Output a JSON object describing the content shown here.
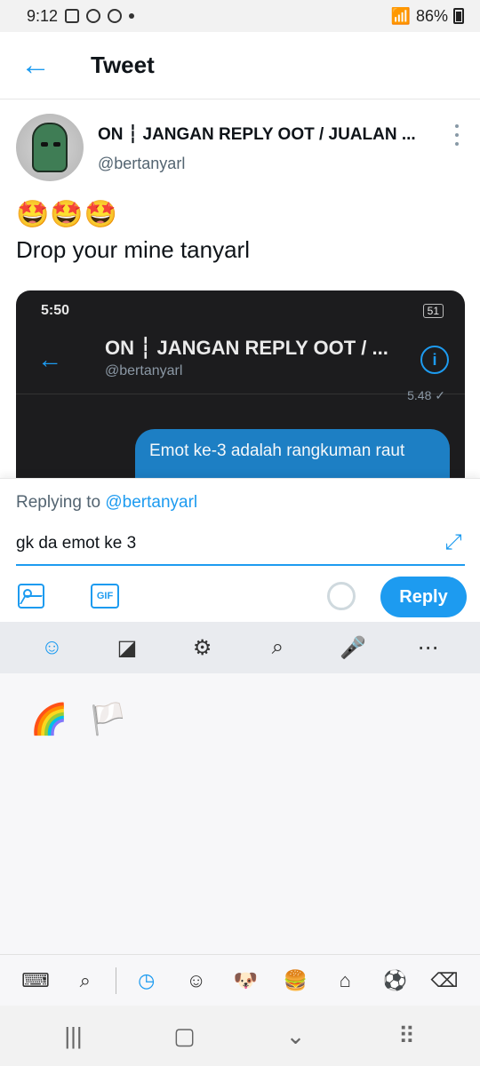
{
  "status_bar": {
    "time": "9:12",
    "battery": "86%"
  },
  "header": {
    "title": "Tweet"
  },
  "tweet": {
    "author_name": "ON ┆ JANGAN REPLY OOT / JUALAN ...",
    "author_handle": "@bertanyarl",
    "emojis": "🤩🤩🤩",
    "text": "Drop your mine tanyarl"
  },
  "embedded_screenshot": {
    "time": "5:50",
    "battery": "51",
    "name": "ON ┆ JANGAN REPLY OOT / ...",
    "handle": "@bertanyarl",
    "message_time": "5.48 ✓",
    "bubble_text": "Emot ke-3 adalah rangkuman raut"
  },
  "reply": {
    "replying_prefix": "Replying to ",
    "replying_handle": "@bertanyarl",
    "input_value": "gk da emot ke 3",
    "gif_label": "GIF",
    "reply_button": "Reply"
  },
  "keyboard_toolbar": {
    "items": [
      {
        "icon": "smiley-icon"
      },
      {
        "icon": "sticker-icon"
      },
      {
        "icon": "gear-icon"
      },
      {
        "icon": "search-icon"
      },
      {
        "icon": "microphone-icon"
      },
      {
        "icon": "more-icon"
      }
    ]
  },
  "emoji_panel": {
    "recent": [
      "🌈",
      "🏳️"
    ]
  },
  "emoji_categories": {
    "items": [
      {
        "icon": "keyboard-icon"
      },
      {
        "icon": "search-icon"
      },
      {
        "icon": "clock-icon"
      },
      {
        "icon": "smiley-icon"
      },
      {
        "icon": "dog-icon"
      },
      {
        "icon": "burger-icon"
      },
      {
        "icon": "house-icon"
      },
      {
        "icon": "ball-icon"
      },
      {
        "icon": "backspace-icon"
      }
    ]
  },
  "colors": {
    "accent": "#1d9bf0",
    "text": "#0f1419",
    "muted": "#536471"
  }
}
